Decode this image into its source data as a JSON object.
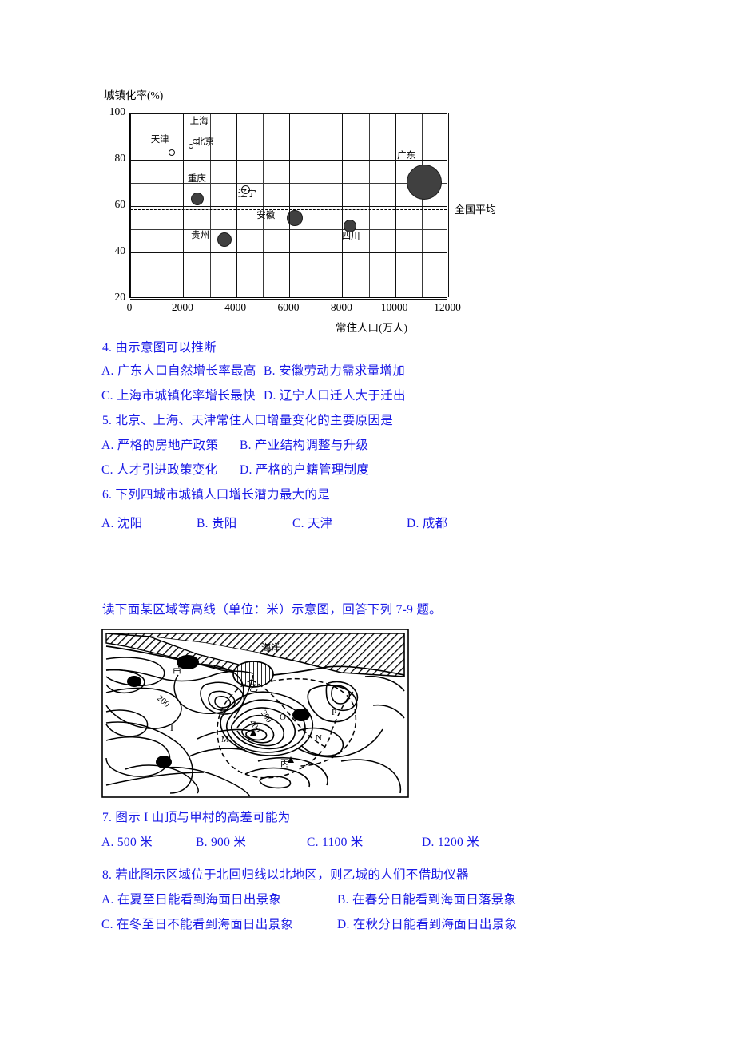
{
  "document": {
    "language": "zh",
    "text_color": "#1a1ae6"
  },
  "chart_data": {
    "type": "scatter",
    "title": "",
    "ylabel": "城镇化率(%)",
    "xlabel": "常住人口(万人)",
    "xlim": [
      0,
      12000
    ],
    "ylim": [
      20,
      100
    ],
    "xticks": [
      "0",
      "2000",
      "4000",
      "6000",
      "8000",
      "10000",
      "12000"
    ],
    "xtick_values": [
      0,
      2000,
      4000,
      6000,
      8000,
      10000,
      12000
    ],
    "yticks": [
      "20",
      "40",
      "60",
      "80",
      "100"
    ],
    "ytick_values": [
      20,
      40,
      60,
      80,
      100
    ],
    "x_minor_step": 1000,
    "y_minor_step": 10,
    "grid": true,
    "legend": "none",
    "reference_line": {
      "label": "全国平均",
      "value": 58.5,
      "style": "dashed"
    },
    "points": [
      {
        "name": "天津",
        "x": 1560,
        "y": 83,
        "size": 8,
        "style": "hollow",
        "label_dx": -26,
        "label_dy": -15
      },
      {
        "name": "上海",
        "x": 2430,
        "y": 88,
        "size": 6,
        "style": "hollow",
        "label_dx": -6,
        "label_dy": -24
      },
      {
        "name": "北京",
        "x": 2290,
        "y": 86,
        "size": 6,
        "style": "hollow",
        "label_dx": 6,
        "label_dy": -4
      },
      {
        "name": "重庆",
        "x": 2530,
        "y": 63,
        "size": 16,
        "style": "filled",
        "label_dx": -12,
        "label_dy": -24
      },
      {
        "name": "辽宁",
        "x": 4370,
        "y": 67,
        "size": 11,
        "style": "hollow",
        "label_dx": -10,
        "label_dy": 6
      },
      {
        "name": "贵州",
        "x": 3560,
        "y": 45.5,
        "size": 18,
        "style": "filled",
        "label_dx": -42,
        "label_dy": -4
      },
      {
        "name": "安徽",
        "x": 6220,
        "y": 55,
        "size": 20,
        "style": "filled",
        "label_dx": -48,
        "label_dy": -2
      },
      {
        "name": "四川",
        "x": 8280,
        "y": 51.5,
        "size": 16,
        "style": "filled",
        "label_dx": -10,
        "label_dy": 14
      },
      {
        "name": "广东",
        "x": 11100,
        "y": 70.5,
        "size": 44,
        "style": "filled",
        "label_dx": -34,
        "label_dy": -32
      }
    ]
  },
  "map": {
    "ocean_label": "海洋",
    "settlements": [
      {
        "label": "甲",
        "name": "jia-village"
      },
      {
        "label": "乙",
        "name": "yi-city"
      },
      {
        "label": "丙",
        "name": "bing-point"
      }
    ],
    "peak_label": "I",
    "contour_labels": [
      "200",
      "200",
      "400"
    ],
    "point_labels": [
      "M",
      "N",
      "O",
      "P"
    ]
  },
  "questions": [
    {
      "number": "4.",
      "stem": "由示意图可以推断",
      "options": [
        {
          "lead": "A.",
          "text": "广东人口自然增长率最高"
        },
        {
          "lead": "B.",
          "text": "安徽劳动力需求量增加"
        },
        {
          "lead": "C.",
          "text": "上海市城镇化率增长最快"
        },
        {
          "lead": "D.",
          "text": "辽宁人口迁人大于迁出"
        }
      ]
    },
    {
      "number": "5.",
      "stem": "北京、上海、天津常住人口增量变化的主要原因是",
      "options": [
        {
          "lead": "A.",
          "text": "严格的房地产政策"
        },
        {
          "lead": "B.",
          "text": "产业结构调整与升级"
        },
        {
          "lead": "C.",
          "text": "人才引进政策变化"
        },
        {
          "lead": "D.",
          "text": "严格的户籍管理制度"
        }
      ]
    },
    {
      "number": "6.",
      "stem": "下列四城市城镇人口增长潜力最大的是",
      "options": [
        {
          "lead": "A.",
          "text": "沈阳"
        },
        {
          "lead": "B.",
          "text": "贵阳"
        },
        {
          "lead": "C.",
          "text": "天津"
        },
        {
          "lead": "D.",
          "text": "成都"
        }
      ]
    },
    {
      "number": "7.",
      "stem": "图示 I 山顶与甲村的高差可能为",
      "options": [
        {
          "lead": "A.",
          "text": "500 米"
        },
        {
          "lead": "B.",
          "text": "900 米"
        },
        {
          "lead": "C.",
          "text": "1100 米"
        },
        {
          "lead": "D.",
          "text": "1200 米"
        }
      ]
    },
    {
      "number": "8.",
      "stem": "若此图示区域位于北回归线以北地区，则乙城的人们不借助仪器",
      "options": [
        {
          "lead": "A.",
          "text": "在夏至日能看到海面日出景象"
        },
        {
          "lead": "B.",
          "text": "在春分日能看到海面日落景象"
        },
        {
          "lead": "C.",
          "text": "在冬至日不能看到海面日出景象"
        },
        {
          "lead": "D.",
          "text": "在秋分日能看到海面日出景象"
        }
      ]
    }
  ],
  "section_intro": "读下面某区域等高线（单位：米）示意图，回答下列 7-9 题。"
}
